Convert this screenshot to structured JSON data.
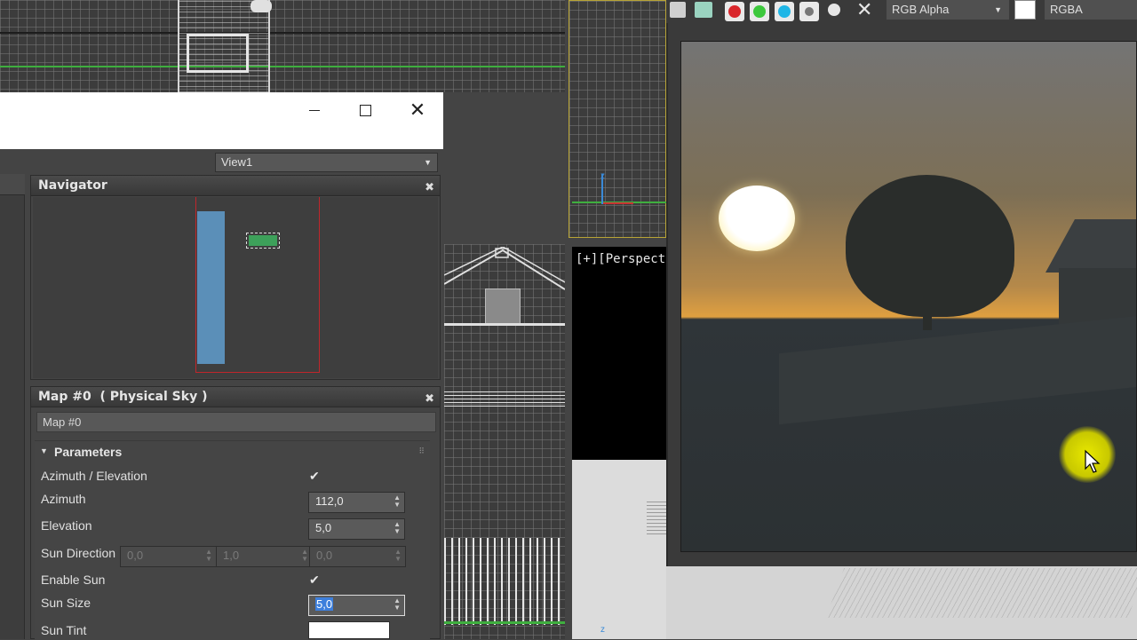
{
  "window": {
    "minimize_icon": "minimize-icon",
    "maximize_icon": "maximize-icon",
    "close_icon": "close-icon"
  },
  "slate": {
    "view_selector": "View1"
  },
  "navigator": {
    "title": "Navigator"
  },
  "map_panel": {
    "title": "Map #0  ( Physical Sky )",
    "name_field": "Map #0",
    "rollout_title": "Parameters",
    "params": [
      {
        "label": "Azimuth / Elevation",
        "checked": true
      },
      {
        "label": "Azimuth",
        "value": "112,0"
      },
      {
        "label": "Elevation",
        "value": "5,0"
      },
      {
        "label": "Sun Direction",
        "values": [
          "0,0",
          "1,0",
          "0,0"
        ]
      },
      {
        "label": "Enable Sun",
        "checked": true
      },
      {
        "label": "Sun Size",
        "value": "5,0"
      },
      {
        "label": "Sun Tint"
      }
    ]
  },
  "viewport": {
    "perspective_label": "[+][Perspective"
  },
  "frame_buffer": {
    "channel_select": "RGB Alpha",
    "channel_label": "RGBA",
    "colors": {
      "red": "#d9262b",
      "green": "#3cc83c",
      "blue": "#1fb6e6"
    }
  },
  "colors": {
    "accent_highlight": "#3d7fdc",
    "viewport_bg": "#3c3c3c",
    "panel_bg": "#444444"
  }
}
